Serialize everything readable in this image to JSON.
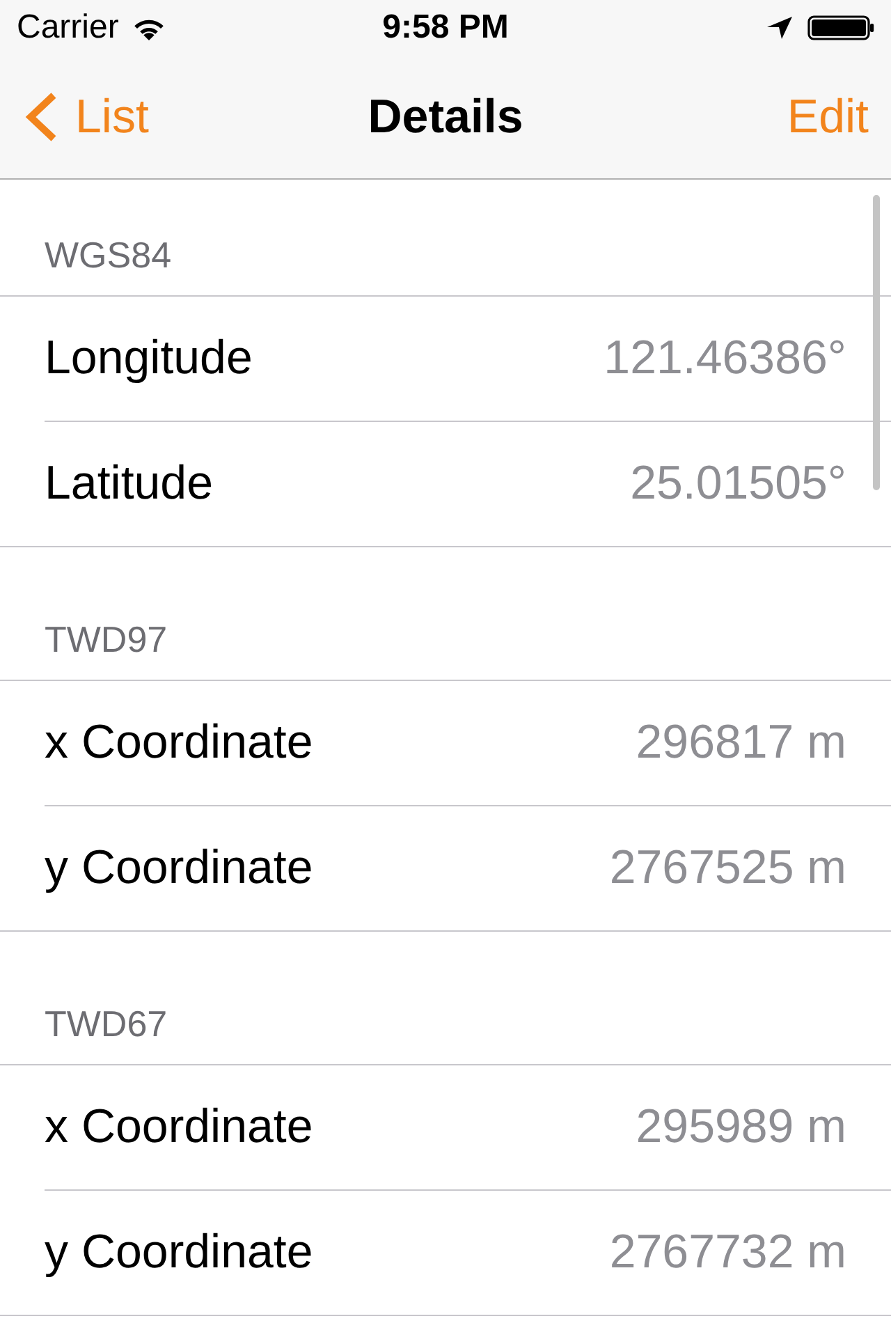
{
  "status_bar": {
    "carrier": "Carrier",
    "time": "9:58 PM"
  },
  "nav_bar": {
    "back_label": "List",
    "title": "Details",
    "action": "Edit"
  },
  "sections": [
    {
      "header": "WGS84",
      "rows": [
        {
          "label": "Longitude",
          "value": "121.46386°"
        },
        {
          "label": "Latitude",
          "value": "25.01505°"
        }
      ]
    },
    {
      "header": "TWD97",
      "rows": [
        {
          "label": "x Coordinate",
          "value": "296817 m"
        },
        {
          "label": "y Coordinate",
          "value": "2767525 m"
        }
      ]
    },
    {
      "header": "TWD67",
      "rows": [
        {
          "label": "x Coordinate",
          "value": "295989 m"
        },
        {
          "label": "y Coordinate",
          "value": "2767732 m"
        }
      ]
    }
  ]
}
